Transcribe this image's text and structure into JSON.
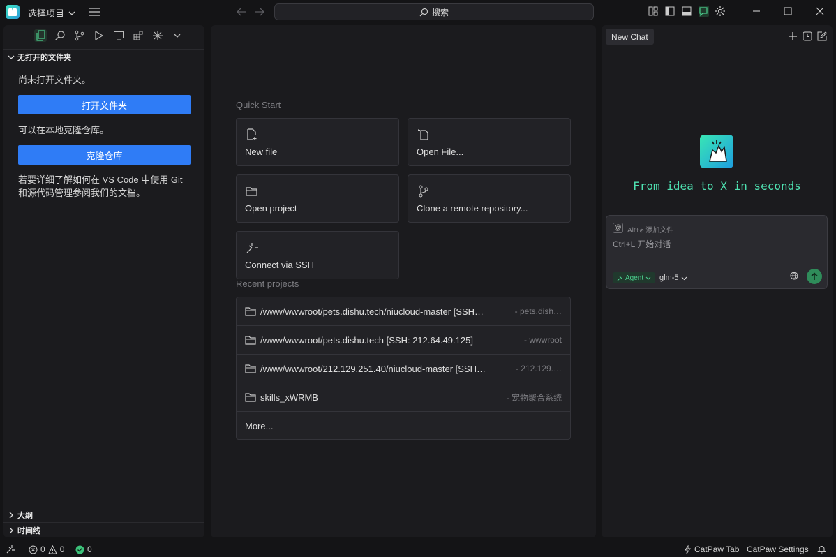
{
  "titlebar": {
    "project_select_label": "选择项目",
    "search_label": "搜索"
  },
  "sidebar": {
    "section_no_folder": "无打开的文件夹",
    "no_folder_text": "尚未打开文件夹。",
    "open_folder_button": "打开文件夹",
    "clone_hint": "可以在本地克隆仓库。",
    "clone_button": "克隆仓库",
    "git_doc_line1": "若要详细了解如何在 VS Code 中使用 Git",
    "git_doc_line2": "和源代码管理参阅我们的文档。",
    "outline_label": "大纲",
    "timeline_label": "时间线"
  },
  "editor": {
    "quick_start_title": "Quick Start",
    "actions": {
      "new_file": "New file",
      "open_file": "Open File...",
      "open_project": "Open project",
      "clone_remote": "Clone a remote repository...",
      "connect_ssh": "Connect via SSH"
    },
    "recent_title": "Recent projects",
    "recent": [
      {
        "path": "/www/wwwroot/pets.dishu.tech/niucloud-master [SSH…",
        "desc": "- pets.dish…"
      },
      {
        "path": "/www/wwwroot/pets.dishu.tech [SSH: 212.64.49.125]",
        "desc": "- wwwroot"
      },
      {
        "path": "/www/wwwroot/212.129.251.40/niucloud-master [SSH…",
        "desc": "- 212.129.…"
      },
      {
        "path": "skills_xWRMB",
        "desc": "- 宠物聚合系统"
      }
    ],
    "more_label": "More..."
  },
  "chat": {
    "tab_label": "New Chat",
    "tagline": "From idea to X in seconds",
    "at_symbol": "@",
    "attach_label": "Alt+⌀ 添加文件",
    "input_placeholder": "Ctrl+L 开始对话",
    "agent_label": "Agent",
    "model_label": "glm-5"
  },
  "status": {
    "errors": "0",
    "warnings": "0",
    "ok_count": "0",
    "catpaw_tab": "CatPaw Tab",
    "catpaw_settings": "CatPaw Settings"
  },
  "colors": {
    "accent_blue": "#2f7cf6",
    "accent_green": "#4ee0b0",
    "background": "#141416",
    "panel": "#1b1b1e"
  }
}
